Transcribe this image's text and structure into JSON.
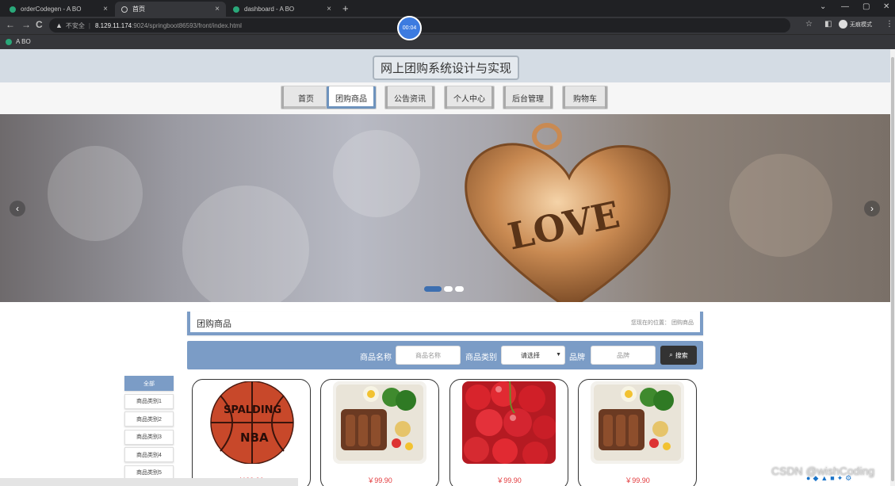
{
  "browser": {
    "tabs": [
      {
        "title": "orderCodegen - A BO"
      },
      {
        "title": "首页"
      },
      {
        "title": "dashboard - A BO"
      }
    ],
    "new_tab": "+",
    "back": "←",
    "forward": "→",
    "reload": "C",
    "security_warning": "不安全",
    "url_host": "8.129.11.174",
    "url_path": ":9024/springboot86593/front/index.html",
    "timer": "00:04",
    "profile_label": "无痕模式",
    "bookmark": "A BO",
    "win_min": "⌄",
    "win_minimize": "—",
    "win_restore": "▢",
    "win_close": "✕"
  },
  "site": {
    "title": "网上团购系统设计与实现",
    "nav": [
      {
        "label": "首页"
      },
      {
        "label": "团购商品"
      },
      {
        "label": "公告资讯"
      },
      {
        "label": "个人中心"
      },
      {
        "label": "后台管理"
      },
      {
        "label": "购物车"
      }
    ],
    "active_nav": 1
  },
  "banner": {
    "text": "LOVE",
    "prev": "‹",
    "next": "›",
    "slide_count": 3,
    "active_slide": 0
  },
  "section": {
    "title": "团购商品",
    "breadcrumb_label": "您现在的位置：",
    "breadcrumb_current": "团购商品"
  },
  "filter": {
    "name_label": "商品名称",
    "name_placeholder": "商品名称",
    "category_label": "商品类别",
    "category_value": "请选择",
    "brand_label": "品牌",
    "brand_placeholder": "品牌",
    "search_button": "搜索"
  },
  "categories": [
    {
      "label": "全部"
    },
    {
      "label": "商品类别1"
    },
    {
      "label": "商品类别2"
    },
    {
      "label": "商品类别3"
    },
    {
      "label": "商品类别4"
    },
    {
      "label": "商品类别5"
    }
  ],
  "products": [
    {
      "image": "basketball",
      "price": "￥99.90"
    },
    {
      "image": "bento",
      "price": "￥99.90"
    },
    {
      "image": "cherries",
      "price": "￥99.90"
    },
    {
      "image": "bento",
      "price": "￥99.90"
    }
  ],
  "overlay": {
    "watermark": "CSDN @wishCoding"
  },
  "colors": {
    "accent": "#7b9cc6",
    "price": "#e2383b",
    "header_bg": "#d4dce4"
  }
}
